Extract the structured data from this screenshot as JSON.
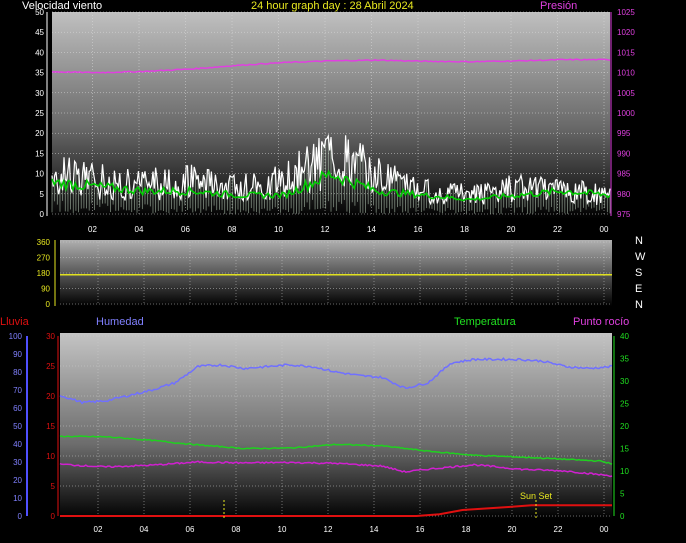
{
  "header": {
    "wind_label": "Velocidad viento",
    "title": "24 hour graph day : 28 Abril 2024",
    "pressure_label": "Presión"
  },
  "compass": [
    "N",
    "W",
    "S",
    "E",
    "N"
  ],
  "bottom_labels": {
    "rain": "Lluvia",
    "humidity": "Humedad",
    "temperature": "Temperatura",
    "dewpoint": "Punto rocío",
    "sunset": "Sun Set"
  },
  "colors": {
    "wind_gust": "#ffffff",
    "wind_avg": "#00cc00",
    "pressure": "#e040e0",
    "direction": "#e0e020",
    "humidity": "#7070ff",
    "temperature": "#20d020",
    "dewpoint": "#d020d0",
    "rain": "#e01010"
  },
  "chart_data": [
    {
      "type": "line",
      "name": "wind-pressure",
      "x_ticks": [
        "02",
        "04",
        "06",
        "08",
        "10",
        "12",
        "14",
        "16",
        "18",
        "20",
        "22",
        "00"
      ],
      "y_left_ticks": [
        "0",
        "5",
        "10",
        "15",
        "20",
        "25",
        "30",
        "35",
        "40",
        "45",
        "50"
      ],
      "y_right_ticks": [
        "975",
        "980",
        "985",
        "990",
        "995",
        "1000",
        "1005",
        "1010",
        "1015",
        "1020",
        "1025"
      ],
      "ylim_left": [
        0,
        50
      ],
      "ylim_right": [
        975,
        1025
      ],
      "series": [
        {
          "x": [
            0,
            2,
            4,
            6,
            8,
            10,
            12,
            14,
            16,
            18,
            20,
            22,
            24
          ],
          "values": [
            6,
            5,
            4,
            4,
            3,
            3,
            8,
            4,
            3,
            2,
            3,
            4,
            3
          ]
        },
        {
          "x": [
            0,
            2,
            4,
            6,
            8,
            10,
            12,
            14,
            16,
            18,
            20,
            22,
            24
          ],
          "values": [
            12,
            10,
            9,
            10,
            8,
            10,
            18,
            12,
            7,
            6,
            8,
            7,
            6
          ]
        },
        {
          "x": [
            0,
            2,
            4,
            6,
            8,
            10,
            12,
            14,
            16,
            18,
            20,
            22,
            24
          ],
          "values": [
            1010.2,
            1010.0,
            1010.3,
            1010.9,
            1011.8,
            1012.5,
            1012.9,
            1013.1,
            1012.8,
            1012.7,
            1012.9,
            1013.2,
            1013.2
          ]
        }
      ]
    },
    {
      "type": "line",
      "name": "wind-direction",
      "x_ticks": [
        "02",
        "04",
        "06",
        "08",
        "10",
        "12",
        "14",
        "16",
        "18",
        "20",
        "22",
        "00"
      ],
      "y_ticks": [
        "0",
        "90",
        "180",
        "270",
        "360"
      ],
      "ylim": [
        0,
        360
      ],
      "series": [
        {
          "x": [
            0,
            24
          ],
          "values": [
            170,
            170
          ]
        }
      ]
    },
    {
      "type": "line",
      "name": "humidity-temperature",
      "x_ticks": [
        "02",
        "04",
        "06",
        "08",
        "10",
        "12",
        "14",
        "16",
        "18",
        "20",
        "22",
        "00"
      ],
      "y_left_humidity_ticks": [
        "0",
        "10",
        "20",
        "30",
        "40",
        "50",
        "60",
        "70",
        "80",
        "90",
        "100"
      ],
      "y_left_rain_ticks": [
        "0",
        "5",
        "10",
        "15",
        "20",
        "25",
        "30"
      ],
      "y_right_ticks": [
        "0",
        "5",
        "10",
        "15",
        "20",
        "25",
        "30",
        "35",
        "40"
      ],
      "ylim_humidity": [
        0,
        100
      ],
      "ylim_rain": [
        0,
        30
      ],
      "ylim_temp": [
        0,
        40
      ],
      "series": [
        {
          "x": [
            0,
            1,
            2,
            3,
            4,
            5,
            6,
            7,
            8,
            9,
            10,
            11,
            12,
            13,
            14,
            15,
            16,
            17,
            18,
            19,
            20,
            21,
            22,
            23,
            24
          ],
          "values": [
            67,
            63,
            64,
            67,
            70,
            74,
            83,
            84,
            82,
            83,
            84,
            83,
            80,
            78,
            77,
            71,
            74,
            85,
            87,
            87,
            87,
            86,
            83,
            82,
            83
          ]
        },
        {
          "x": [
            0,
            2,
            4,
            6,
            8,
            10,
            12,
            14,
            16,
            18,
            20,
            22,
            23.5,
            24
          ],
          "values": [
            17.7,
            17.6,
            16.8,
            15.8,
            15.0,
            15.1,
            15.9,
            15.6,
            14.4,
            13.5,
            13.1,
            12.6,
            12.2,
            11.6
          ]
        },
        {
          "x": [
            0,
            2,
            4,
            6,
            8,
            10,
            12,
            14,
            15,
            16,
            18,
            20,
            22,
            24
          ],
          "values": [
            11.5,
            10.9,
            11.3,
            12.0,
            11.8,
            11.9,
            11.7,
            11.1,
            9.8,
            10.4,
            11.4,
            10.4,
            10.0,
            8.9
          ]
        },
        {
          "x": [
            0,
            15.5,
            16.5,
            17.5,
            19.5,
            20.5,
            24
          ],
          "values": [
            0,
            0,
            0.3,
            1.0,
            1.5,
            1.8,
            1.8
          ]
        }
      ]
    }
  ]
}
